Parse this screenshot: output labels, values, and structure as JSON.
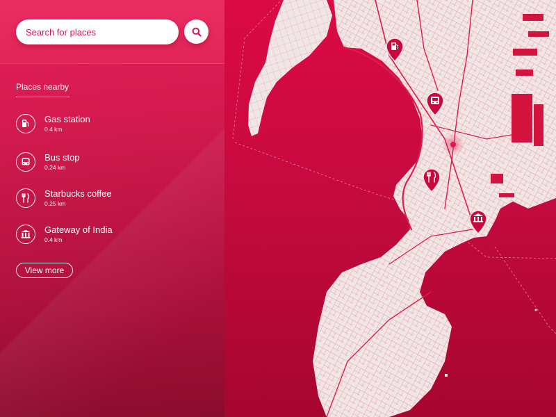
{
  "search": {
    "placeholder": "Search for places",
    "button_icon": "search-icon"
  },
  "nearby": {
    "title": "Places nearby",
    "places": [
      {
        "name": "Gas station",
        "distance": "0.4 km",
        "icon": "gas-pump-icon"
      },
      {
        "name": "Bus stop",
        "distance": "0.24 km",
        "icon": "bus-icon"
      },
      {
        "name": "Starbucks coffee",
        "distance": "0.25 km",
        "icon": "fork-knife-icon"
      },
      {
        "name": "Gateway of India",
        "distance": "0.4 km",
        "icon": "monument-icon"
      }
    ],
    "view_more_label": "View more"
  },
  "map": {
    "markers": [
      {
        "icon": "gas-pump-icon"
      },
      {
        "icon": "bus-icon"
      },
      {
        "icon": "fork-knife-icon"
      },
      {
        "icon": "monument-icon"
      }
    ],
    "current_location": true
  },
  "colors": {
    "accent": "#d4164d",
    "sea": "#c8083f",
    "land": "#f1e6e6",
    "road": "#d91a48",
    "text_on_accent": "#ffffff"
  }
}
